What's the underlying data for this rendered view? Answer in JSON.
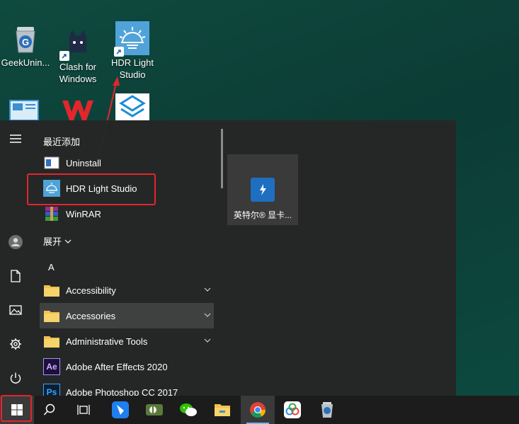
{
  "desktop": {
    "icons": [
      {
        "label": "GeekUnin...",
        "icon": "recycle-bin-icon"
      },
      {
        "label": "Clash for\nWindows",
        "icon": "clash-cat-icon"
      },
      {
        "label": "HDR Light\nStudio",
        "icon": "hdr-light-studio-icon"
      }
    ]
  },
  "start_menu": {
    "rail": [
      {
        "name": "hamburger-menu-icon"
      },
      {
        "name": "user-avatar-icon"
      },
      {
        "name": "documents-icon"
      },
      {
        "name": "pictures-icon"
      },
      {
        "name": "settings-gear-icon"
      },
      {
        "name": "power-icon"
      }
    ],
    "recently_added_label": "最近添加",
    "recent_apps": [
      {
        "label": "Uninstall"
      },
      {
        "label": "HDR Light Studio"
      },
      {
        "label": "WinRAR"
      }
    ],
    "expand_label": "展开",
    "letter_header": "A",
    "apps": [
      {
        "label": "Accessibility",
        "type": "folder"
      },
      {
        "label": "Accessories",
        "type": "folder"
      },
      {
        "label": "Administrative Tools",
        "type": "folder"
      },
      {
        "label": "Adobe After Effects 2020",
        "type": "app",
        "badge": "Ae"
      },
      {
        "label": "Adobe Photoshop CC 2017",
        "type": "app",
        "badge": "Ps"
      }
    ],
    "tile": {
      "label": "英特尔® 显卡..."
    }
  },
  "taskbar": {
    "items": [
      {
        "name": "start-button"
      },
      {
        "name": "search-icon"
      },
      {
        "name": "task-view-icon"
      },
      {
        "name": "feishu-icon"
      },
      {
        "name": "app-green-icon"
      },
      {
        "name": "wechat-icon"
      },
      {
        "name": "file-explorer-icon"
      },
      {
        "name": "chrome-icon"
      },
      {
        "name": "baidu-netdisk-icon"
      },
      {
        "name": "geek-uninstaller-icon"
      }
    ]
  },
  "colors": {
    "annotation": "#e2262c",
    "desktop_bg": "#0f4a3f",
    "menu_bg": "#262626",
    "folder": "#f2c14e"
  }
}
